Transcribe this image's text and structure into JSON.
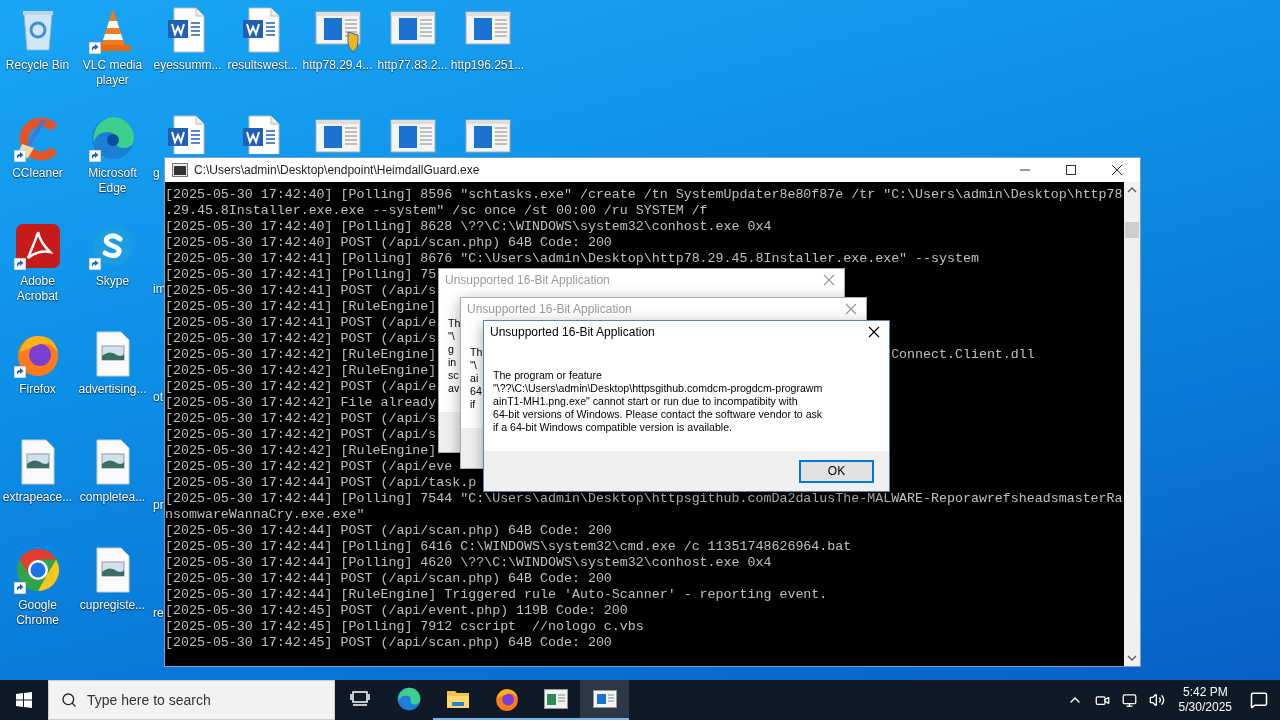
{
  "desktop_icon_rows": [
    [
      {
        "kind": "recycle",
        "label": "Recycle Bin"
      },
      {
        "kind": "vlc",
        "label": "VLC media player",
        "shortcut": true
      },
      {
        "kind": "word",
        "label": "eyessumm..."
      },
      {
        "kind": "word",
        "label": "resultswest..."
      },
      {
        "kind": "exe-shield",
        "label": "http78.29.4..."
      },
      {
        "kind": "exe",
        "label": "http77.83.2..."
      },
      {
        "kind": "exe",
        "label": "http196.251..."
      }
    ],
    [
      {
        "kind": "ccleaner",
        "label": "CCleaner",
        "shortcut": true
      },
      {
        "kind": "edge",
        "label": "Microsoft Edge",
        "shortcut": true
      },
      {
        "kind": "word",
        "label": "g",
        "label_cut": true,
        "icon_cut": true
      },
      {
        "kind": "word",
        "icon_cut": true
      },
      {
        "kind": "exe",
        "icon_cut": true
      },
      {
        "kind": "exe",
        "icon_cut": true
      },
      {
        "kind": "exe",
        "icon_cut": true
      }
    ],
    [
      {
        "kind": "acrobat",
        "label": "Adobe Acrobat",
        "shortcut": true
      },
      {
        "kind": "skype",
        "label": "Skype",
        "shortcut": true
      },
      {
        "kind": "hidden",
        "label": "im",
        "label_cut": true
      }
    ],
    [
      {
        "kind": "firefox",
        "label": "Firefox",
        "shortcut": true
      },
      {
        "kind": "image",
        "label": "advertising..."
      },
      {
        "kind": "hidden",
        "label": "ot",
        "label_cut": true
      }
    ],
    [
      {
        "kind": "image",
        "label": "extrapeace..."
      },
      {
        "kind": "image",
        "label": "completea..."
      },
      {
        "kind": "hidden",
        "label": "pr",
        "label_cut": true
      }
    ],
    [
      {
        "kind": "chrome",
        "label": "Google Chrome",
        "shortcut": true
      },
      {
        "kind": "image",
        "label": "cupregiste..."
      },
      {
        "kind": "hidden",
        "label": "re",
        "label_cut": true
      }
    ]
  ],
  "console": {
    "title": "C:\\Users\\admin\\Desktop\\endpoint\\HeimdallGuard.exe",
    "lines": [
      {
        "text": "[2025-05-30 17:42:40] [Polling] 8596 \"schtasks.exe\" /create /tn SystemUpdater8e80f87e /tr \"C:\\Users\\admin\\Desktop\\http78"
      },
      {
        "text": ".29.45.8Installer.exe.exe --system\" /sc once /st 00:00 /ru SYSTEM /f"
      },
      {
        "text": "[2025-05-30 17:42:40] [Polling] 8628 \\??\\C:\\WINDOWS\\system32\\conhost.exe 0x4"
      },
      {
        "text": "[2025-05-30 17:42:40] POST (/api/scan.php) 64B Code: 200"
      },
      {
        "text": "[2025-05-30 17:42:41] [Polling] 8676 \"C:\\Users\\admin\\Desktop\\http78.29.45.8Installer.exe.exe\" --system"
      },
      {
        "text": "[2025-05-30 17:42:41] [Polling] 75"
      },
      {
        "text": "[2025-05-30 17:42:41] POST (/api/s"
      },
      {
        "text": "[2025-05-30 17:42:41] [RuleEngine]"
      },
      {
        "text": "[2025-05-30 17:42:41] POST (/api/e"
      },
      {
        "text": "[2025-05-30 17:42:42] POST (/api/s"
      },
      {
        "text": "[2025-05-30 17:42:42] [RuleEngine]",
        "tail": "Connect.Client.dll"
      },
      {
        "text": "[2025-05-30 17:42:42] [RuleEngine]"
      },
      {
        "text": "[2025-05-30 17:42:42] POST (/api/e"
      },
      {
        "text": "[2025-05-30 17:42:42] File already"
      },
      {
        "text": "[2025-05-30 17:42:42] POST (/api/s"
      },
      {
        "text": "[2025-05-30 17:42:42] POST (/api/s"
      },
      {
        "text": "[2025-05-30 17:42:42] [RuleEngine]"
      },
      {
        "text": "[2025-05-30 17:42:42] POST (/api/eve"
      },
      {
        "text": "[2025-05-30 17:42:44] POST (/api/task.p"
      },
      {
        "text": "[2025-05-30 17:42:44] [Polling] 7544 \"C:\\Users\\admin\\Desktop\\httpsgithub.comDa2dalusThe-MALWARE-ReporawrefsheadsmasterRa"
      },
      {
        "text": "nsomwareWannaCry.exe.exe\""
      },
      {
        "text": "[2025-05-30 17:42:44] POST (/api/scan.php) 64B Code: 200"
      },
      {
        "text": "[2025-05-30 17:42:44] [Polling] 6416 C:\\WINDOWS\\system32\\cmd.exe /c 11351748626964.bat"
      },
      {
        "text": "[2025-05-30 17:42:44] [Polling] 4620 \\??\\C:\\WINDOWS\\system32\\conhost.exe 0x4"
      },
      {
        "text": "[2025-05-30 17:42:44] POST (/api/scan.php) 64B Code: 200"
      },
      {
        "text": "[2025-05-30 17:42:44] [RuleEngine] Triggered rule 'Auto-Scanner' - reporting event."
      },
      {
        "text": "[2025-05-30 17:42:45] POST (/api/event.php) 119B Code: 200"
      },
      {
        "text": "[2025-05-30 17:42:45] [Polling] 7912 cscript  //nologo c.vbs"
      },
      {
        "text": "[2025-05-30 17:42:45] POST (/api/scan.php) 64B Code: 200"
      }
    ]
  },
  "dialogs": [
    {
      "title": "Unsupported 16-Bit Application",
      "active": false,
      "message_lines": [
        "Th",
        "\"\\",
        "g",
        "in",
        "sc",
        "av"
      ]
    },
    {
      "title": "Unsupported 16-Bit Application",
      "active": false,
      "message_lines": [
        "Th",
        "\"\\",
        "ai",
        "64",
        "if"
      ]
    },
    {
      "title": "Unsupported 16-Bit Application",
      "active": true,
      "message_lines": [
        "The program or feature",
        "\"\\??\\C:\\Users\\admin\\Desktop\\httpsgithub.comdcm-progdcm-prograwm",
        "ainT1-MH1.png.exe\" cannot start or run due to incompatibity with",
        "64-bit versions of Windows. Please contact the software vendor to ask",
        "if a 64-bit Windows compatible version is available."
      ],
      "ok_button": "OK"
    }
  ],
  "taskbar": {
    "search": {
      "placeholder": "Type here to search"
    },
    "apps": [
      {
        "kind": "taskview",
        "running": false,
        "selected": false
      },
      {
        "kind": "edge",
        "running": false,
        "selected": false
      },
      {
        "kind": "explorer",
        "running": true,
        "selected": false
      },
      {
        "kind": "firefox",
        "running": true,
        "selected": false
      },
      {
        "kind": "app",
        "running": true,
        "selected": false
      },
      {
        "kind": "console",
        "running": true,
        "selected": true
      }
    ],
    "time": "5:42 PM",
    "date": "5/30/2025"
  }
}
